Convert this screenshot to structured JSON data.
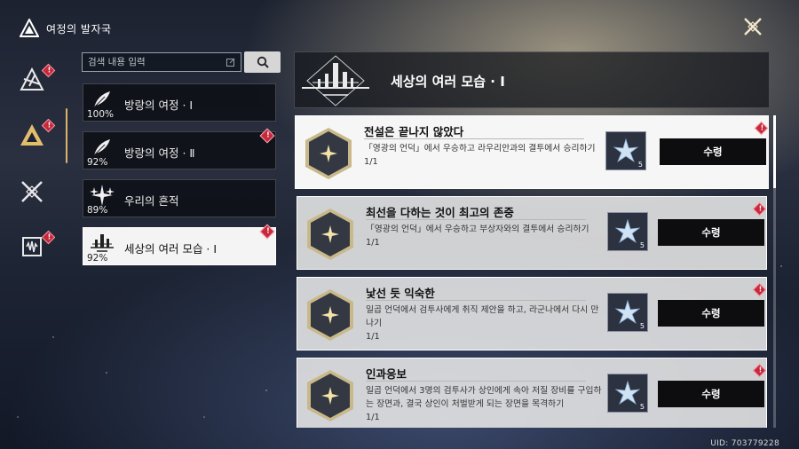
{
  "app": {
    "title": "여정의 발자국"
  },
  "search": {
    "placeholder": "검색 내용 입력"
  },
  "categories": [
    {
      "label": "방랑의 여정 · Ⅰ",
      "percent": "100%",
      "icon": "feather-icon",
      "badge": false,
      "selected": false
    },
    {
      "label": "방랑의 여정 · Ⅱ",
      "percent": "92%",
      "icon": "feather-icon",
      "badge": true,
      "selected": false
    },
    {
      "label": "우리의 흔적",
      "percent": "89%",
      "icon": "sparkle-icon",
      "badge": false,
      "selected": false
    },
    {
      "label": "세상의 여러 모습 · Ⅰ",
      "percent": "92%",
      "icon": "city-emblem-icon",
      "badge": true,
      "selected": true
    }
  ],
  "header": {
    "title": "세상의 여러 모습 · Ⅰ"
  },
  "achievements": [
    {
      "title": "전설은 끝나지 않았다",
      "description": "「영광의 언덕」에서 우승하고 라우리안과의 결투에서 승리하기",
      "progress": "1/1",
      "reward_qty": "5",
      "claim_label": "수령"
    },
    {
      "title": "최선을 다하는 것이 최고의 존중",
      "description": "「영광의 언덕」에서 우승하고 부상자와의 결투에서 승리하기",
      "progress": "1/1",
      "reward_qty": "5",
      "claim_label": "수령"
    },
    {
      "title": "낯선 듯 익숙한",
      "description": "일곱 언덕에서 검투사에게 취직 제안을 하고, 라군나에서 다시 만나기",
      "progress": "1/1",
      "reward_qty": "5",
      "claim_label": "수령"
    },
    {
      "title": "인과응보",
      "description": "일곱 언덕에서 3명의 검투사가 상인에게 속아 저질 장비를 구입하는 장면과, 결국 상인이 처벌받게 되는 장면을 목격하기",
      "progress": "1/1",
      "reward_qty": "5",
      "claim_label": "수령"
    }
  ],
  "uid": "UID: 703779228",
  "colors": {
    "accent": "#d9b56a",
    "badge": "#c9283c"
  }
}
